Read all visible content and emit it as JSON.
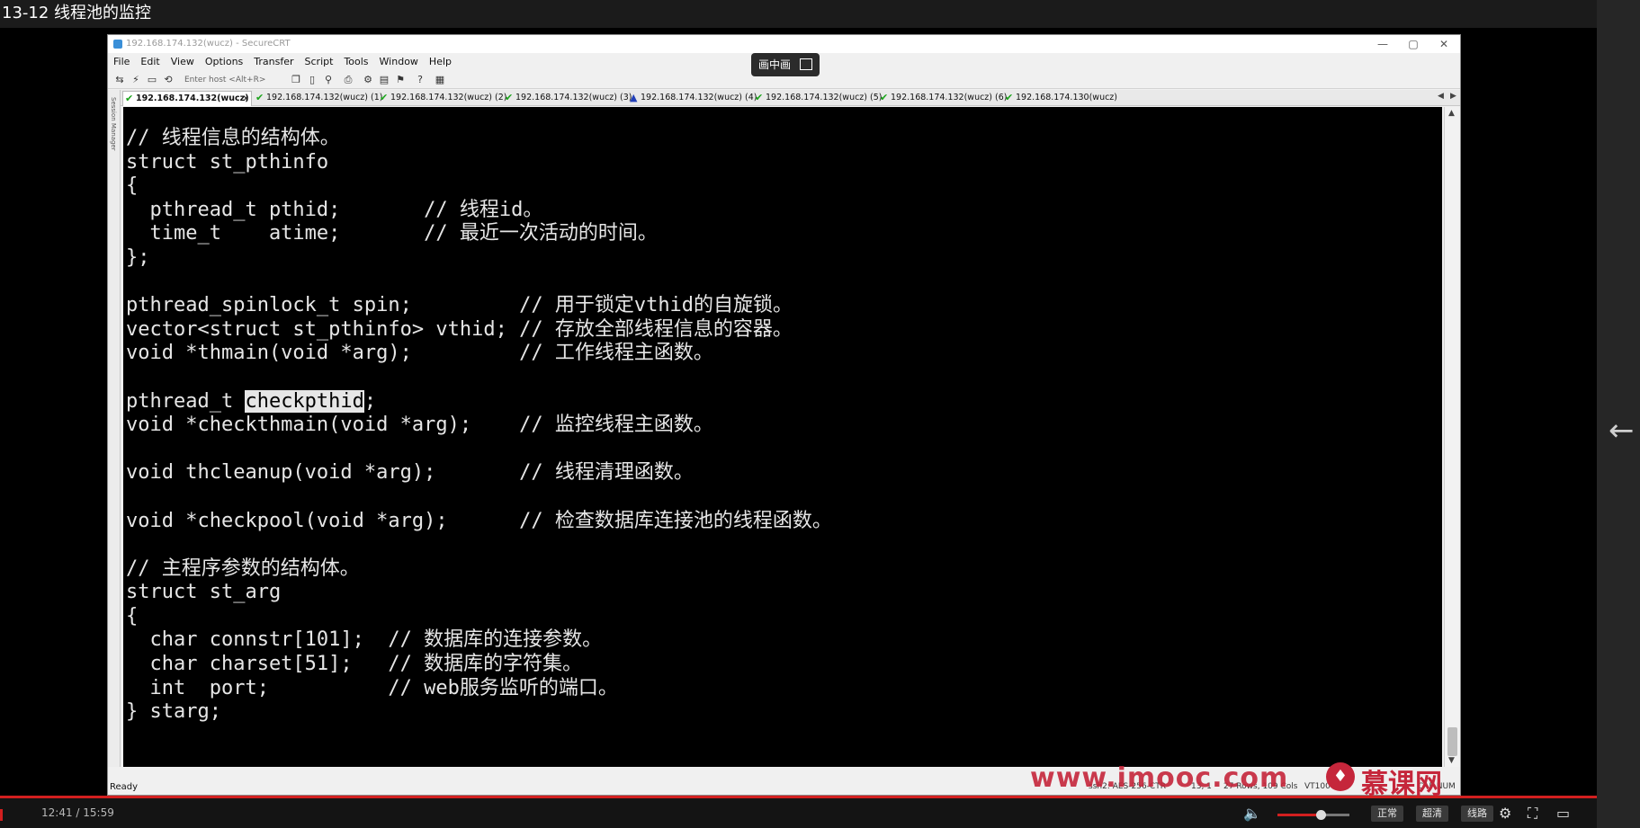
{
  "video": {
    "title": "13-12 线程池的监控",
    "time": "12:41 / 15:59",
    "progress": 0.795,
    "volume": 0.6,
    "speed_label": "正常",
    "quality_label": "超清",
    "route_label": "线路"
  },
  "window": {
    "title": "192.168.174.132(wucz) - SecureCRT",
    "pip_label": "画中画",
    "minimize": "—",
    "maximize": "▢",
    "close": "✕"
  },
  "menu": [
    "File",
    "Edit",
    "View",
    "Options",
    "Transfer",
    "Script",
    "Tools",
    "Window",
    "Help"
  ],
  "toolbar": {
    "host_placeholder": "Enter host <Alt+R>"
  },
  "tabs": [
    {
      "label": "192.168.174.132(wucz)",
      "status": "ok",
      "active": true,
      "close": "x"
    },
    {
      "label": "192.168.174.132(wucz) (1)",
      "status": "ok"
    },
    {
      "label": "192.168.174.132(wucz) (2)",
      "status": "ok"
    },
    {
      "label": "192.168.174.132(wucz) (3)",
      "status": "ok"
    },
    {
      "label": "192.168.174.132(wucz) (4)",
      "status": "warn"
    },
    {
      "label": "192.168.174.132(wucz) (5)",
      "status": "ok"
    },
    {
      "label": "192.168.174.132(wucz) (6)",
      "status": "ok"
    },
    {
      "label": "192.168.174.130(wucz)",
      "status": "ok"
    }
  ],
  "session_manager_label": "Session Manager",
  "terminal": {
    "lines": [
      "// 线程信息的结构体。",
      "struct st_pthinfo",
      "{",
      "  pthread_t pthid;       // 线程id。",
      "  time_t    atime;       // 最近一次活动的时间。",
      "};",
      "",
      "pthread_spinlock_t spin;         // 用于锁定vthid的自旋锁。",
      "vector<struct st_pthinfo> vthid; // 存放全部线程信息的容器。",
      "void *thmain(void *arg);         // 工作线程主函数。",
      "",
      "pthread_t |checkpthid|;",
      "void *checkthmain(void *arg);    // 监控线程主函数。",
      "",
      "void thcleanup(void *arg);       // 线程清理函数。",
      "",
      "void *checkpool(void *arg);      // 检查数据库连接池的线程函数。",
      "",
      "// 主程序参数的结构体。",
      "struct st_arg",
      "{",
      "  char connstr[101];  // 数据库的连接参数。",
      "  char charset[51];   // 数据库的字符集。",
      "  int  port;          // web服务监听的端口。",
      "} starg;"
    ]
  },
  "status": {
    "ready": "Ready",
    "cipher": "ssh2: AES-256-CTR",
    "position": "13,  1",
    "size": "27 Rows, 109 Cols",
    "term": "VT100",
    "caps": "CAP  NUM"
  },
  "watermark": {
    "url": "www.imooc.com",
    "logo": "♦",
    "cn": "慕课网"
  }
}
